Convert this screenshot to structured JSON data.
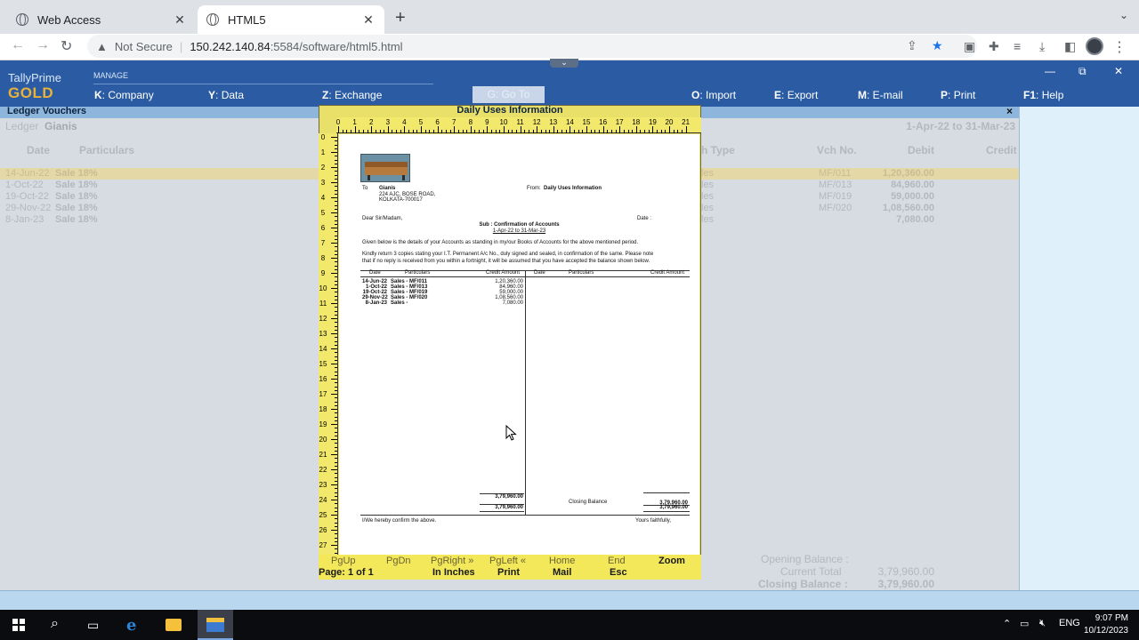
{
  "browser": {
    "tabs": [
      {
        "title": "Web Access",
        "active": false
      },
      {
        "title": "HTML5",
        "active": true
      }
    ],
    "url": {
      "security_label": "Not Secure",
      "host": "150.242.140.84",
      "rest": ":5584/software/html5.html"
    }
  },
  "tally": {
    "brand_top": "TallyPrime",
    "brand_bottom": "GOLD",
    "manage_label": "MANAGE",
    "menu": [
      {
        "key": "K",
        "label": "Company"
      },
      {
        "key": "Y",
        "label": "Data"
      },
      {
        "key": "Z",
        "label": "Exchange"
      },
      {
        "key": "G",
        "label": "Go To"
      },
      {
        "key": "O",
        "label": "Import"
      },
      {
        "key": "E",
        "label": "Export"
      },
      {
        "key": "M",
        "label": "E-mail"
      },
      {
        "key": "P",
        "label": "Print"
      },
      {
        "key": "F1",
        "label": "Help"
      }
    ],
    "screen_title": "Ledger Vouchers",
    "ledger_label": "Ledger",
    "ledger_name": "Gianis",
    "period": "1-Apr-22 to 31-Mar-23",
    "columns": {
      "date": "Date",
      "particulars": "Particulars",
      "vch_type": "h Type",
      "vch_no": "Vch No.",
      "debit": "Debit",
      "credit": "Credit"
    },
    "rows": [
      {
        "date": "14-Jun-22",
        "particulars": "Sale 18%",
        "vch_type": "les",
        "vch_no": "MF/011",
        "debit": "1,20,360.00"
      },
      {
        "date": "1-Oct-22",
        "particulars": "Sale 18%",
        "vch_type": "les",
        "vch_no": "MF/013",
        "debit": "84,960.00"
      },
      {
        "date": "19-Oct-22",
        "particulars": "Sale 18%",
        "vch_type": "les",
        "vch_no": "MF/019",
        "debit": "59,000.00"
      },
      {
        "date": "29-Nov-22",
        "particulars": "Sale 18%",
        "vch_type": "les",
        "vch_no": "MF/020",
        "debit": "1,08,560.00"
      },
      {
        "date": "8-Jan-23",
        "particulars": "Sale 18%",
        "vch_type": "les",
        "vch_no": "",
        "debit": "7,080.00"
      }
    ],
    "totals": {
      "opening_label": "Opening Balance :",
      "current_label": "Current Total",
      "current_value": "3,79,960.00",
      "closing_label": "Closing Balance :",
      "closing_value": "3,79,960.00"
    }
  },
  "preview": {
    "title": "Daily Uses Information",
    "close": "×",
    "ruler_top": [
      "0",
      "1",
      "2",
      "3",
      "4",
      "5",
      "6",
      "7",
      "8",
      "9",
      "10",
      "11",
      "12",
      "13",
      "14",
      "15",
      "16",
      "17",
      "18",
      "19",
      "20",
      "21"
    ],
    "ruler_left": [
      "0",
      "1",
      "2",
      "3",
      "4",
      "5",
      "6",
      "7",
      "8",
      "9",
      "10",
      "11",
      "12",
      "13",
      "14",
      "15",
      "16",
      "17",
      "18",
      "19",
      "20",
      "21",
      "22",
      "23",
      "24",
      "25",
      "26",
      "27"
    ],
    "letter": {
      "to_label": "To",
      "to_name": "Gianis",
      "to_address1": "224 AJC, BOSE ROAD,",
      "to_address2": "KOLKATA-700017",
      "from_label": "From:",
      "from_name": "Daily Uses Information",
      "salutation": "Dear Sir/Madam,",
      "date_label": "Date :",
      "subject": "Sub : Confirmation of Accounts",
      "subject_period": "1-Apr-22 to 31-Mar-23",
      "para1": "Given below is the details of your Accounts as standing in my/our Books of Accounts for the above mentioned period.",
      "para2a": "Kindly return 3 copies stating your I.T. Permanent A/c No., duly signed and sealed, in confirmation of the same. Please note",
      "para2b": "that if no reply is received from you within a fortnight, it will be assumed that you have accepted the balance shown below.",
      "headers": {
        "date": "Date",
        "particulars": "Particulars",
        "credit": "Credit Amount",
        "date2": "Date",
        "particulars2": "Particulars",
        "credit2": "Credit Amount"
      },
      "rows": [
        {
          "date": "14-Jun-22",
          "particulars": "Sales - MF/011",
          "amount": "1,20,360.00"
        },
        {
          "date": "1-Oct-22",
          "particulars": "Sales - MF/013",
          "amount": "84,960.00"
        },
        {
          "date": "19-Oct-22",
          "particulars": "Sales - MF/019",
          "amount": "59,000.00"
        },
        {
          "date": "29-Nov-22",
          "particulars": "Sales - MF/020",
          "amount": "1,08,560.00"
        },
        {
          "date": "8-Jan-23",
          "particulars": "Sales -",
          "amount": "7,080.00"
        }
      ],
      "left_total": "3,79,960.00",
      "left_total2": "3,79,960.00",
      "closing_label": "Closing Balance",
      "closing_value": "3,79,960.00",
      "right_total": "3,79,960.00",
      "confirm_text": "I/We hereby confirm the above.",
      "sign_off": "Yours faithfully,"
    },
    "footer_row1": [
      "PgUp",
      "PgDn",
      "PgRight »",
      "PgLeft «",
      "Home",
      "End",
      "Zoom"
    ],
    "footer_row2": [
      "Page: 1 of 1",
      "In Inches",
      "Print",
      "Mail",
      "Esc"
    ]
  },
  "taskbar": {
    "lang": "ENG",
    "time": "9:07 PM",
    "date": "10/12/2023"
  }
}
